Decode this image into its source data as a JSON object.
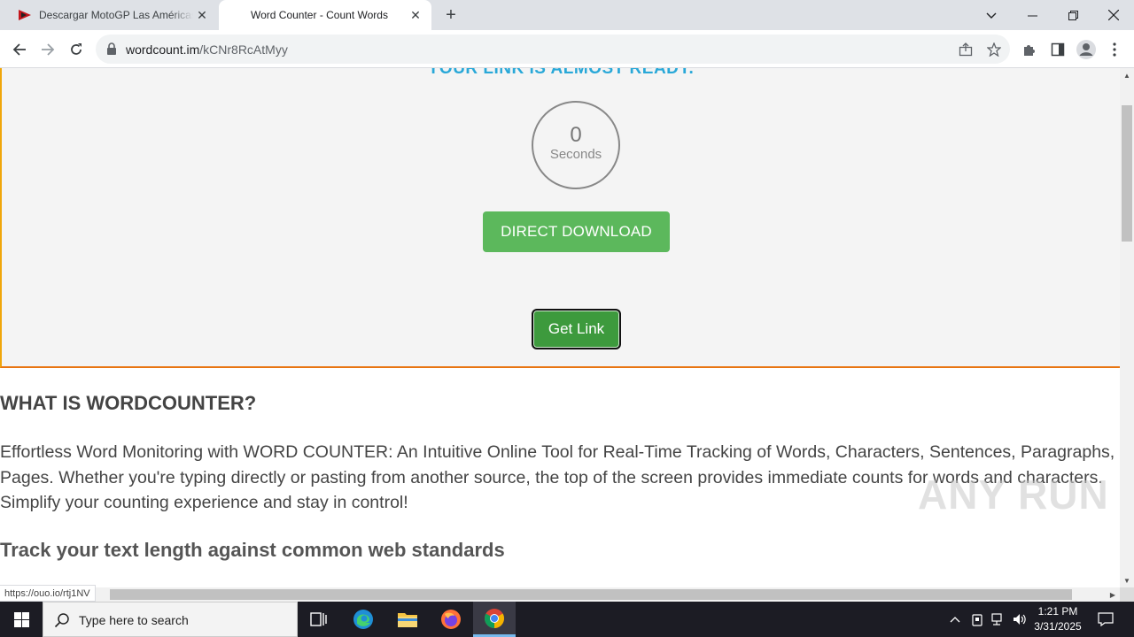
{
  "browser": {
    "tabs": [
      {
        "title": "Descargar MotoGP Las Américas",
        "active": false
      },
      {
        "title": "Word Counter - Count Words",
        "active": true
      }
    ],
    "address": {
      "host": "wordcount.im",
      "path": "/kCNr8RcAtMyy"
    },
    "status_url": "https://ouo.io/rtj1NV"
  },
  "page": {
    "ready_heading": "YOUR LINK IS ALMOST READY.",
    "timer": {
      "value": "0",
      "label": "Seconds"
    },
    "direct_download_label": "DIRECT DOWNLOAD",
    "get_link_label": "Get Link",
    "what_heading": "WHAT IS WORDCOUNTER?",
    "intro_paragraph": "Effortless Word Monitoring with WORD COUNTER: An Intuitive Online Tool for Real-Time Tracking of Words, Characters, Sentences, Paragraphs, and Pages. Whether you're typing directly or pasting from another source, the top of the screen provides immediate counts for words and characters. Simplify your counting experience and stay in control!",
    "track_heading": "Track your text length against common web standards"
  },
  "watermark": "ANY RUN",
  "taskbar": {
    "search_placeholder": "Type here to search",
    "time": "1:21 PM",
    "date": "3/31/2025"
  },
  "colors": {
    "accent_heading": "#29a8d8",
    "download_button": "#5cb85c",
    "get_link_button": "#3d9a3d",
    "panel_border_left": "#f0a60a",
    "panel_border_bottom": "#e87511"
  }
}
